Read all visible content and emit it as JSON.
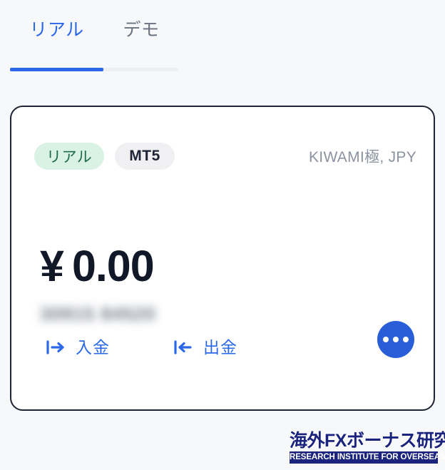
{
  "tabs": [
    {
      "label": "リアル",
      "active": true,
      "name": "tab-real"
    },
    {
      "label": "デモ",
      "active": false,
      "name": "tab-demo"
    }
  ],
  "card": {
    "type_badge": "リアル",
    "platform_badge": "MT5",
    "account_meta": "KIWAMI極, JPY",
    "account_number_masked": "30915 84520",
    "balance": {
      "currency_symbol": "¥",
      "amount": "0.00"
    },
    "actions": [
      {
        "label": "入金",
        "icon": "arrow-right-from-bar-icon",
        "name": "deposit-button"
      },
      {
        "label": "出金",
        "icon": "arrow-left-to-bar-icon",
        "name": "withdraw-button"
      }
    ],
    "more_button": {
      "icon": "more-horizontal-icon",
      "dots": 3
    }
  },
  "watermark": {
    "title": "海外FXボーナス研究所",
    "subtitle": "RESEARCH INSTITUTE FOR OVERSEASFX BONUS"
  },
  "colors": {
    "accent_blue": "#2a68e8",
    "fab_blue": "#2a5ed8",
    "badge_green_bg": "#d9f2e3",
    "badge_green_text": "#1d6b4c",
    "badge_gray_bg": "#f0f0f3",
    "text_dark": "#111827",
    "text_muted": "#8b93a1",
    "page_bg": "#f7f8fa",
    "card_border": "#1e2433",
    "watermark_navy": "#1a237e"
  }
}
